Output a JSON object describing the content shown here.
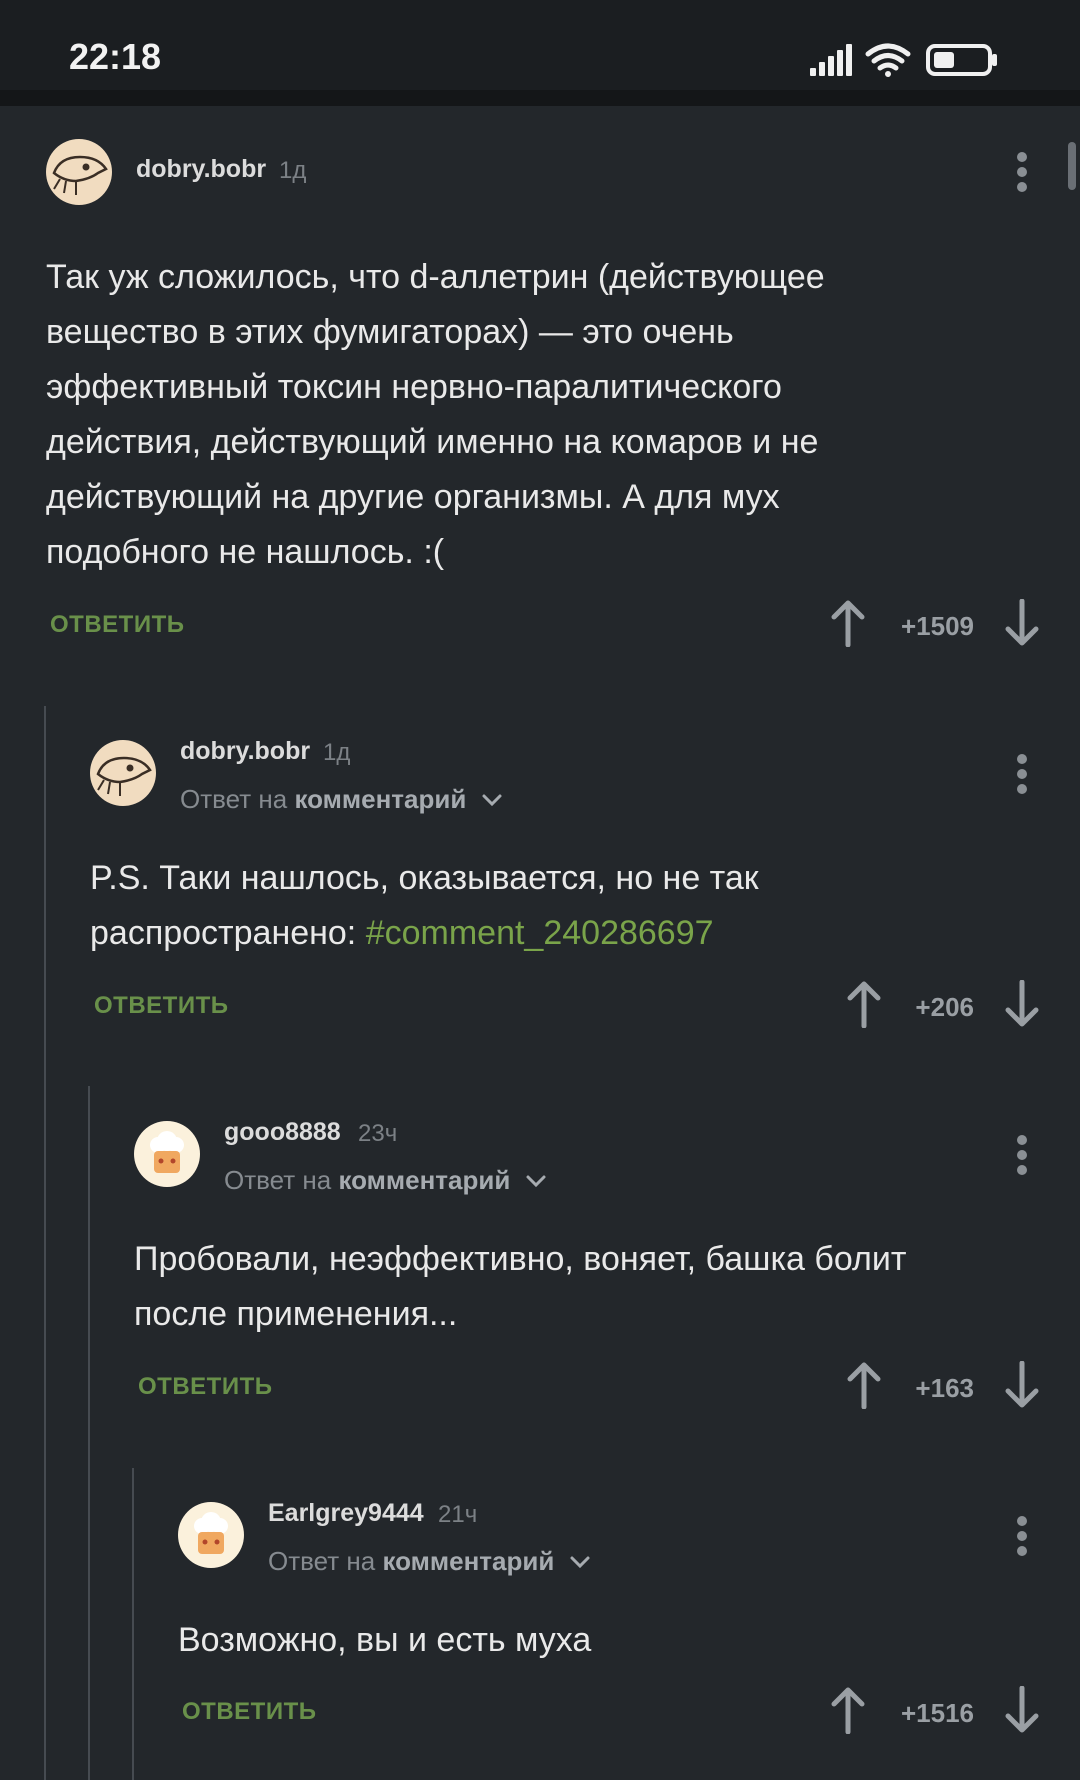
{
  "status_bar": {
    "time": "22:18"
  },
  "comments": [
    {
      "user": "dobry.bobr",
      "time": "1д",
      "text_lines": [
        "Так уж сложилось, что d-аллетрин (действующее",
        "вещество в этих фумигаторах) — это очень",
        "эффективный токсин нервно-паралитического",
        "действия, действующий именно на комаров и не",
        "действующий на другие организмы. А для мух",
        "подобного не нашлось. :("
      ],
      "reply_label": "ОТВЕТИТЬ",
      "score": "+1509"
    },
    {
      "user": "dobry.bobr",
      "time": "1д",
      "reply_to_prefix": "Ответ на",
      "reply_to_target": "комментарий",
      "text_line1": "P.S. Таки нашлось, оказывается, но не так",
      "text_line2_prefix": "распространено: ",
      "text_link": "#comment_240286697",
      "reply_label": "ОТВЕТИТЬ",
      "score": "+206"
    },
    {
      "user": "gooo8888",
      "time": "23ч",
      "reply_to_prefix": "Ответ на",
      "reply_to_target": "комментарий",
      "text_lines": [
        "Пробовали, неэффективно, воняет, башка болит",
        "после применения..."
      ],
      "reply_label": "ОТВЕТИТЬ",
      "score": "+163"
    },
    {
      "user": "Earlgrey9444",
      "time": "21ч",
      "reply_to_prefix": "Ответ на",
      "reply_to_target": "комментарий",
      "text_lines": [
        "Возможно, вы и есть муха"
      ],
      "reply_label": "ОТВЕТИТЬ",
      "score": "+1516"
    }
  ],
  "colors": {
    "background": "#23272b",
    "accent_green": "#69904a",
    "link_green": "#7aa44a"
  }
}
